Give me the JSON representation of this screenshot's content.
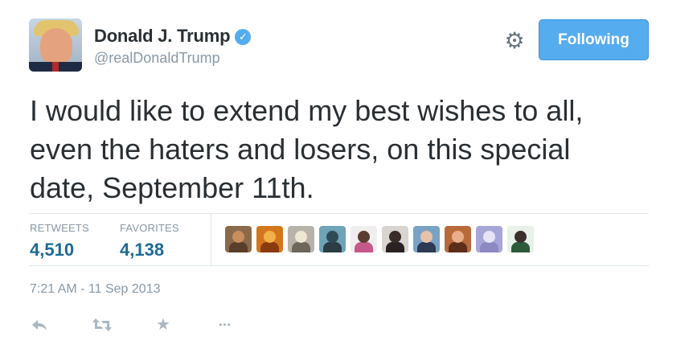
{
  "author": {
    "display_name": "Donald J. Trump",
    "handle": "@realDonaldTrump",
    "verified_icon": "verified-badge-icon",
    "verified_glyph": "✓"
  },
  "header": {
    "settings_icon": "gear-icon",
    "settings_glyph": "⚙",
    "follow_button_label": "Following"
  },
  "tweet": {
    "text": "I would like to extend my best wishes to all, even the haters and losers, on this special date, September 11th.",
    "timestamp": "7:21 AM - 11 Sep 2013"
  },
  "stats": {
    "retweets_label": "RETWEETS",
    "retweets_count": "4,510",
    "favorites_label": "FAVORITES",
    "favorites_count": "4,138"
  },
  "favoriters": [
    {
      "name": "favoriter-avatar-1",
      "bg": "#8a6a4a",
      "head": "#c98e5d",
      "body": "#5a3d2a"
    },
    {
      "name": "favoriter-avatar-2",
      "bg": "#d4761c",
      "head": "#f2b04a",
      "body": "#8a3b0e"
    },
    {
      "name": "favoriter-avatar-3",
      "bg": "#b8b3aa",
      "head": "#efe6d4",
      "body": "#6e665a"
    },
    {
      "name": "favoriter-avatar-4",
      "bg": "#6fa3b8",
      "head": "#304a55",
      "body": "#2b3c44"
    },
    {
      "name": "favoriter-avatar-5",
      "bg": "#f0eeee",
      "head": "#5a3c31",
      "body": "#c55a8a"
    },
    {
      "name": "favoriter-avatar-6",
      "bg": "#d9d4cf",
      "head": "#3a2c26",
      "body": "#2a2222"
    },
    {
      "name": "favoriter-avatar-7",
      "bg": "#7aa2c4",
      "head": "#e6c3a8",
      "body": "#2c3a52"
    },
    {
      "name": "favoriter-avatar-8",
      "bg": "#b86a3a",
      "head": "#e7b08a",
      "body": "#5c2e1a"
    },
    {
      "name": "favoriter-avatar-9",
      "bg": "#a7a6d8",
      "head": "#e8e4f5",
      "body": "#8d88c2"
    },
    {
      "name": "favoriter-avatar-10",
      "bg": "#e8f0ea",
      "head": "#3a2f2a",
      "body": "#2e5a3c"
    }
  ],
  "actions": {
    "reply_icon": "reply-icon",
    "retweet_icon": "retweet-icon",
    "favorite_icon": "star-icon",
    "favorite_glyph": "★",
    "more_icon": "more-icon",
    "more_glyph": "•••"
  },
  "colors": {
    "accent": "#55acee",
    "text": "#292f33",
    "muted": "#8899a6",
    "count": "#1d6a94",
    "icon": "#aab8c2"
  }
}
